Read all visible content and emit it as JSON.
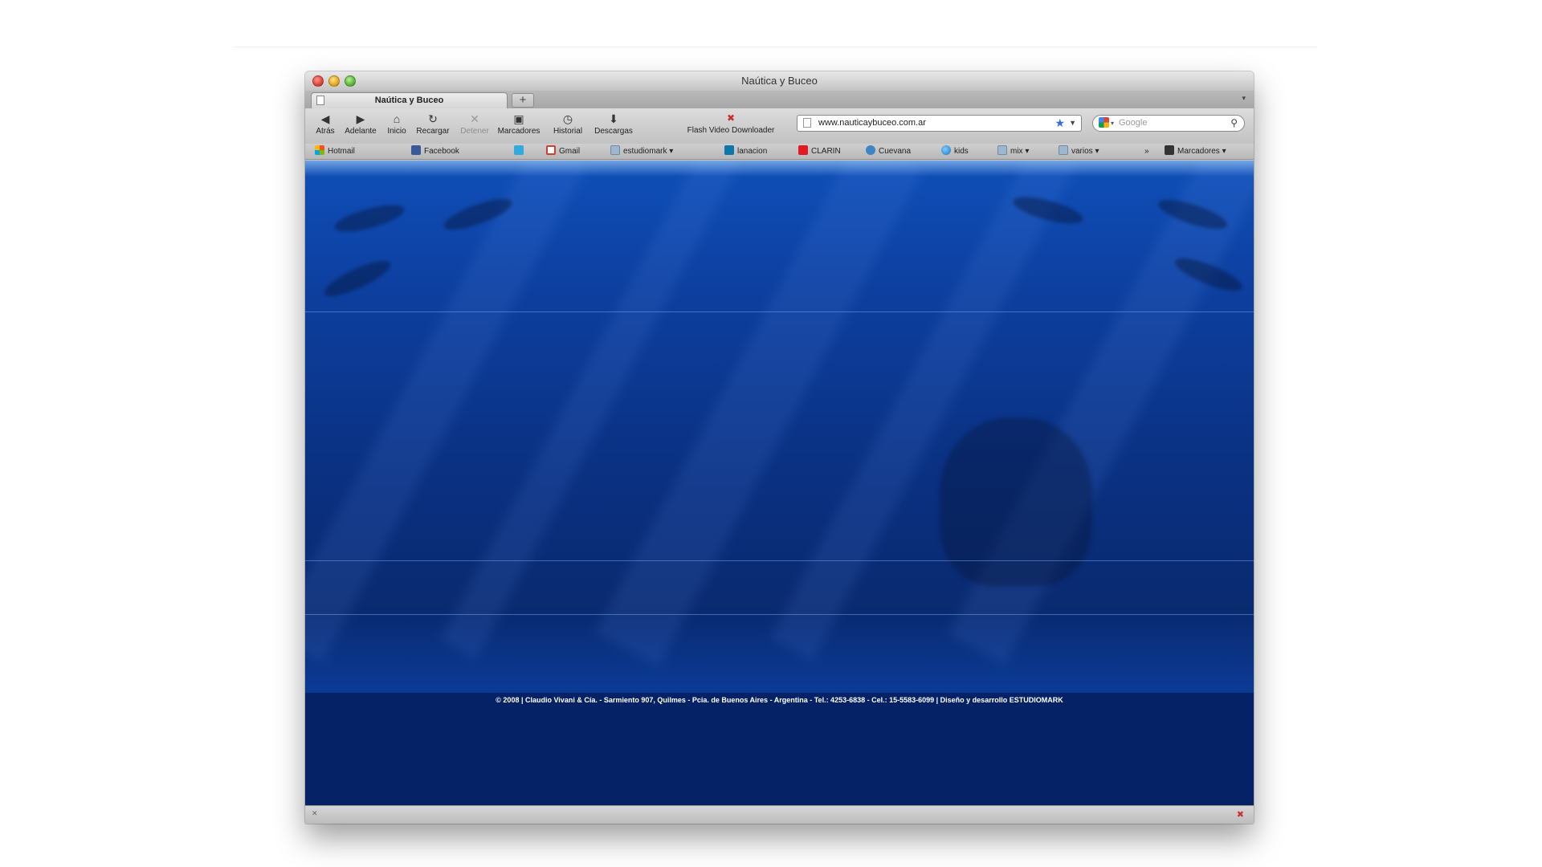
{
  "window": {
    "title": "Naútica y Buceo",
    "tab_title": "Naútica y Buceo",
    "new_tab_label": "+"
  },
  "toolbar": {
    "buttons": [
      {
        "label": "Atrás",
        "icon": "◀",
        "enabled": true
      },
      {
        "label": "Adelante",
        "icon": "▶",
        "enabled": true
      },
      {
        "label": "Inicio",
        "icon": "⌂",
        "enabled": true
      },
      {
        "label": "Recargar",
        "icon": "↻",
        "enabled": true
      },
      {
        "label": "Detener",
        "icon": "✕",
        "enabled": false
      },
      {
        "label": "Marcadores",
        "icon": "▣",
        "enabled": true
      },
      {
        "label": "Historial",
        "icon": "◷",
        "enabled": true
      },
      {
        "label": "Descargas",
        "icon": "⬇",
        "enabled": true
      }
    ],
    "flash_label": "Flash Video Downloader",
    "flash_icon": "✖",
    "url": "www.nauticaybuceo.com.ar",
    "search_placeholder": "Google"
  },
  "bookmarks": [
    {
      "label": "Hotmail",
      "icon": "hotmail-icon"
    },
    {
      "label": "Facebook",
      "icon": "facebook-icon"
    },
    {
      "label": "",
      "icon": "twitter-icon"
    },
    {
      "label": "Gmail",
      "icon": "gmail-icon"
    },
    {
      "label": "estudiomark ▾",
      "icon": "folder-icon"
    },
    {
      "label": "lanacion",
      "icon": "linkedin-icon"
    },
    {
      "label": "CLARIN",
      "icon": "clarin-icon"
    },
    {
      "label": "Cuevana",
      "icon": "cuevana-icon"
    },
    {
      "label": "kids",
      "icon": "globe-icon"
    },
    {
      "label": "mix ▾",
      "icon": "folder-icon"
    },
    {
      "label": "varios ▾",
      "icon": "folder-icon"
    },
    {
      "label": "»",
      "icon": ""
    },
    {
      "label": "Marcadores ▾",
      "icon": "bookmarks-icon"
    }
  ],
  "content": {
    "footer": "© 2008 | Claudio Vivani & Cía. - Sarmiento 907, Quilmes - Pcia. de Buenos Aires - Argentina - Tel.: 4253-6838 - Cel.: 15-5583-6099 | Diseño y desarrollo ESTUDIOMARK"
  },
  "colors": {
    "ocean": "#0d3f9f",
    "footer_band": "#062266"
  }
}
